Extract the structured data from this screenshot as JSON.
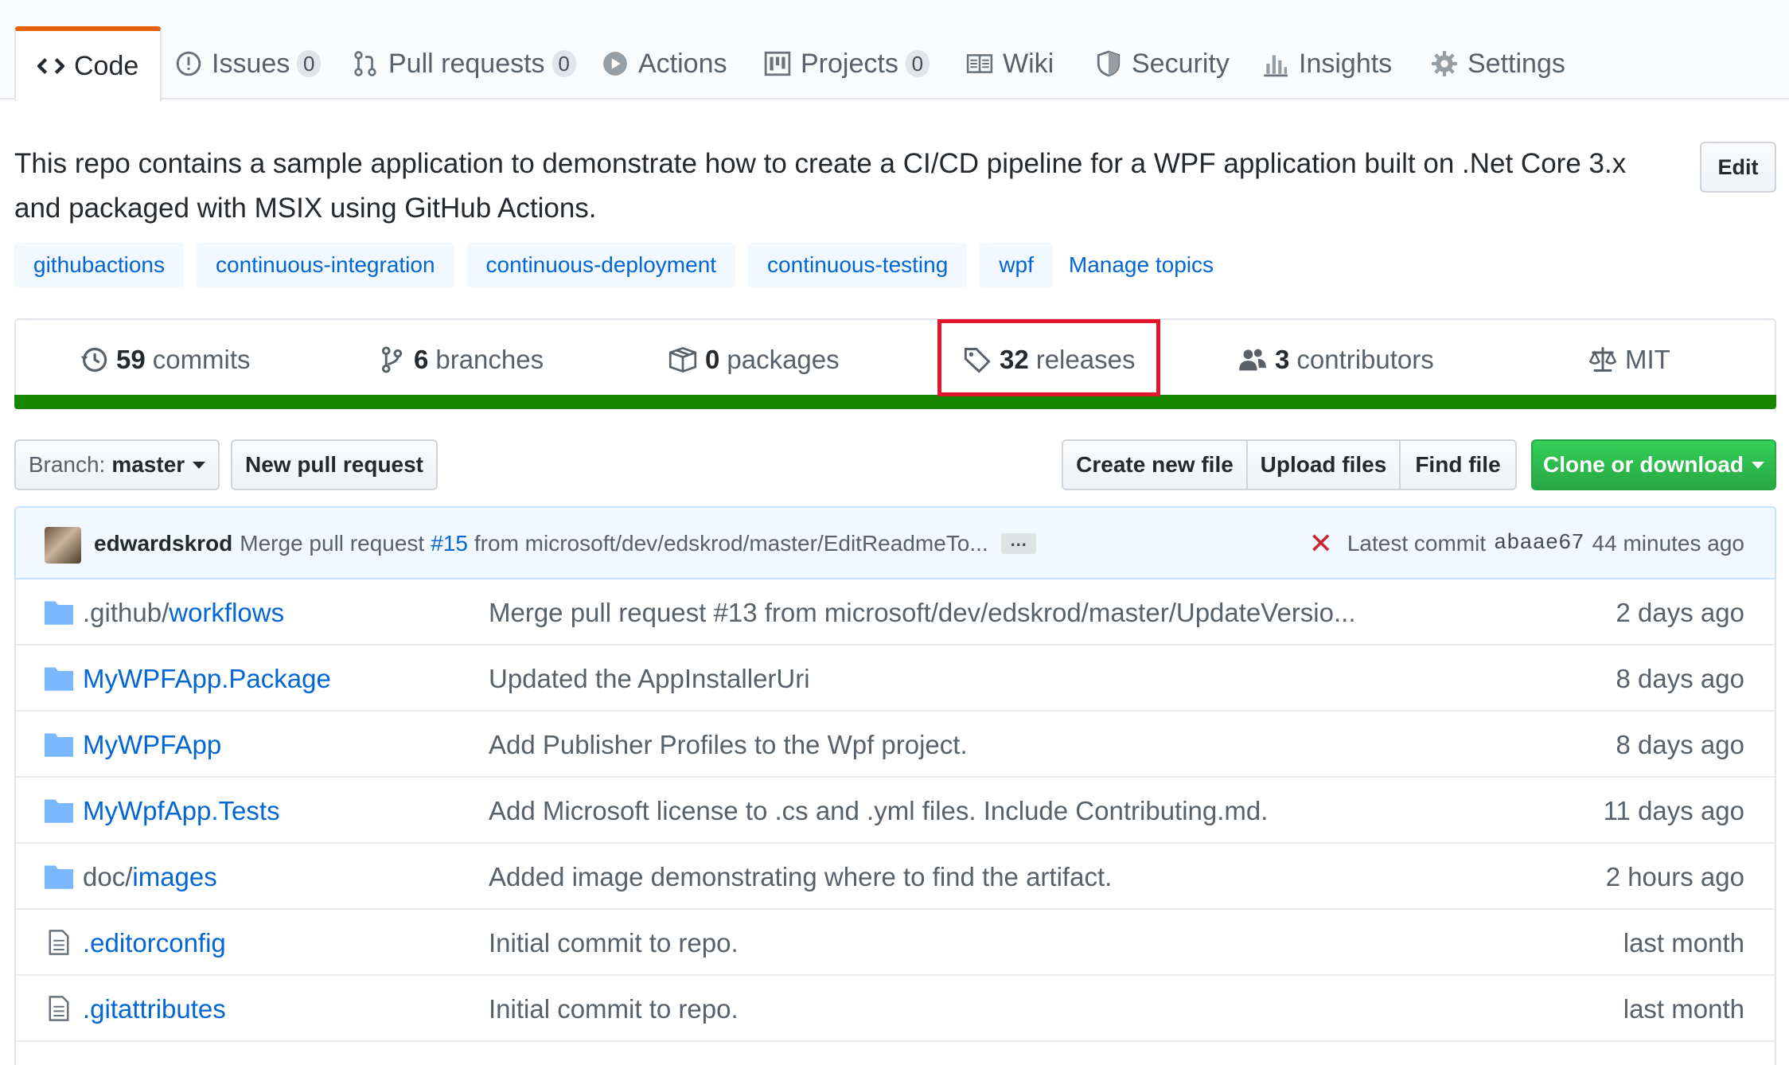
{
  "tabs": [
    {
      "label": "Code",
      "icon": "code-icon",
      "selected": true
    },
    {
      "label": "Issues",
      "icon": "issue-icon",
      "count": "0"
    },
    {
      "label": "Pull requests",
      "icon": "pull-request-icon",
      "count": "0"
    },
    {
      "label": "Actions",
      "icon": "play-icon"
    },
    {
      "label": "Projects",
      "icon": "project-icon",
      "count": "0"
    },
    {
      "label": "Wiki",
      "icon": "book-icon"
    },
    {
      "label": "Security",
      "icon": "shield-icon"
    },
    {
      "label": "Insights",
      "icon": "graph-icon"
    },
    {
      "label": "Settings",
      "icon": "gear-icon"
    }
  ],
  "repo": {
    "description_line1": "This repo contains a sample application to demonstrate how to create a CI/CD pipeline for a WPF application built on .Net Core 3.x",
    "description_line2": "and packaged with MSIX using GitHub Actions.",
    "edit_label": "Edit",
    "topics": [
      "githubactions",
      "continuous-integration",
      "continuous-deployment",
      "continuous-testing",
      "wpf"
    ],
    "manage_topics": "Manage topics"
  },
  "summary": {
    "commits": {
      "num": "59",
      "label": "commits"
    },
    "branches": {
      "num": "6",
      "label": "branches"
    },
    "packages": {
      "num": "0",
      "label": "packages"
    },
    "releases": {
      "num": "32",
      "label": "releases"
    },
    "contributors": {
      "num": "3",
      "label": "contributors"
    },
    "license": "MIT",
    "language_color": "#178600",
    "highlight_color": "#e3162d"
  },
  "toolbar": {
    "branch_prefix": "Branch:",
    "branch_name": "master",
    "new_pr": "New pull request",
    "create_file": "Create new file",
    "upload_files": "Upload files",
    "find_file": "Find file",
    "clone": "Clone or download"
  },
  "commit": {
    "author": "edwardskrod",
    "message_pre": "Merge pull request",
    "pr_link": "#15",
    "message_post": "from microsoft/dev/edskrod/master/EditReadmeTo...",
    "ellipsis": "…",
    "status_icon": "x-icon",
    "latest_label": "Latest commit",
    "sha": "abaae67",
    "age": "44 minutes ago"
  },
  "files": [
    {
      "type": "folder",
      "prefix": ".github/",
      "name": "workflows",
      "message": "Merge pull request #13 from microsoft/dev/edskrod/master/UpdateVersio...",
      "age": "2 days ago"
    },
    {
      "type": "folder",
      "prefix": "",
      "name": "MyWPFApp.Package",
      "message": "Updated the AppInstallerUri",
      "age": "8 days ago"
    },
    {
      "type": "folder",
      "prefix": "",
      "name": "MyWPFApp",
      "message": "Add Publisher Profiles to the Wpf project.",
      "age": "8 days ago"
    },
    {
      "type": "folder",
      "prefix": "",
      "name": "MyWpfApp.Tests",
      "message": "Add Microsoft license to .cs and .yml files. Include Contributing.md.",
      "age": "11 days ago"
    },
    {
      "type": "folder",
      "prefix": "doc/",
      "name": "images",
      "message": "Added image demonstrating where to find the artifact.",
      "age": "2 hours ago"
    },
    {
      "type": "file",
      "prefix": "",
      "name": ".editorconfig",
      "message": "Initial commit to repo.",
      "age": "last month"
    },
    {
      "type": "file",
      "prefix": "",
      "name": ".gitattributes",
      "message": "Initial commit to repo.",
      "age": "last month"
    }
  ]
}
